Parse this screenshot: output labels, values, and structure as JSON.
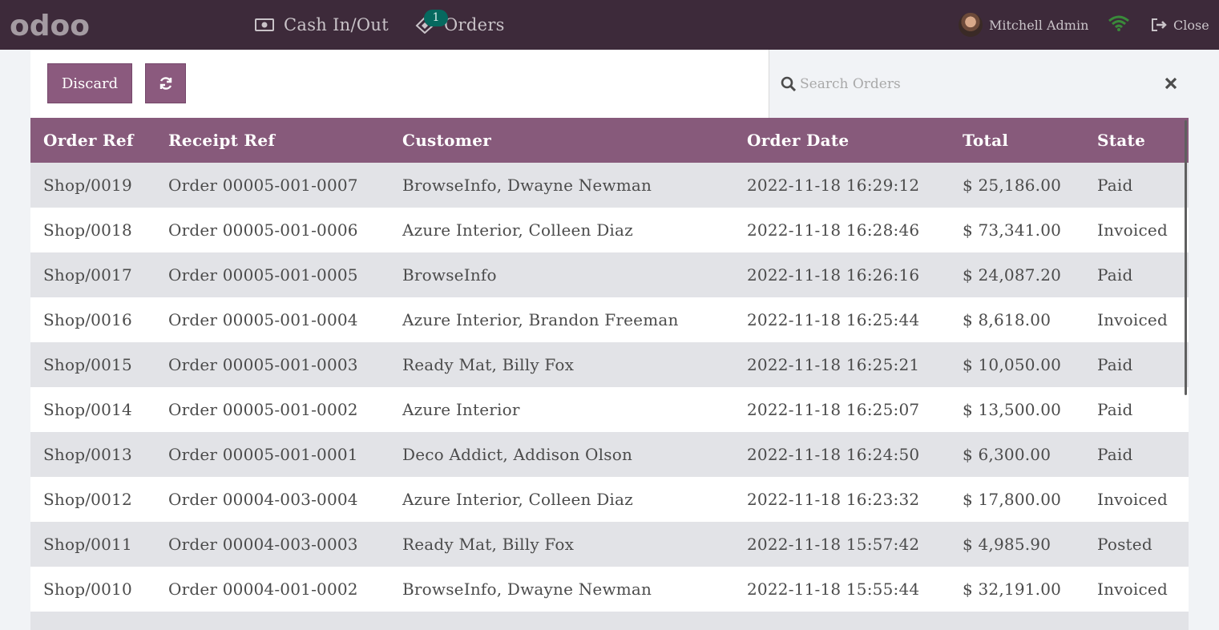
{
  "navbar": {
    "logo_text": "odoo",
    "cash_label": "Cash In/Out",
    "orders_label": "Orders",
    "orders_badge": "1",
    "user_name": "Mitchell Admin",
    "close_label": "Close",
    "wifi_color": "#3a8a3a"
  },
  "controls": {
    "discard_label": "Discard",
    "search_placeholder": "Search Orders"
  },
  "table": {
    "columns": [
      "Order Ref",
      "Receipt Ref",
      "Customer",
      "Order Date",
      "Total",
      "State"
    ],
    "rows": [
      [
        "Shop/0019",
        "Order 00005-001-0007",
        "BrowseInfo, Dwayne Newman",
        "2022-11-18 16:29:12",
        "$ 25,186.00",
        "Paid"
      ],
      [
        "Shop/0018",
        "Order 00005-001-0006",
        "Azure Interior, Colleen Diaz",
        "2022-11-18 16:28:46",
        "$ 73,341.00",
        "Invoiced"
      ],
      [
        "Shop/0017",
        "Order 00005-001-0005",
        "BrowseInfo",
        "2022-11-18 16:26:16",
        "$ 24,087.20",
        "Paid"
      ],
      [
        "Shop/0016",
        "Order 00005-001-0004",
        "Azure Interior, Brandon Freeman",
        "2022-11-18 16:25:44",
        "$ 8,618.00",
        "Invoiced"
      ],
      [
        "Shop/0015",
        "Order 00005-001-0003",
        "Ready Mat, Billy Fox",
        "2022-11-18 16:25:21",
        "$ 10,050.00",
        "Paid"
      ],
      [
        "Shop/0014",
        "Order 00005-001-0002",
        "Azure Interior",
        "2022-11-18 16:25:07",
        "$ 13,500.00",
        "Paid"
      ],
      [
        "Shop/0013",
        "Order 00005-001-0001",
        "Deco Addict, Addison Olson",
        "2022-11-18 16:24:50",
        "$ 6,300.00",
        "Paid"
      ],
      [
        "Shop/0012",
        "Order 00004-003-0004",
        "Azure Interior, Colleen Diaz",
        "2022-11-18 16:23:32",
        "$ 17,800.00",
        "Invoiced"
      ],
      [
        "Shop/0011",
        "Order 00004-003-0003",
        "Ready Mat, Billy Fox",
        "2022-11-18 15:57:42",
        "$ 4,985.90",
        "Posted"
      ],
      [
        "Shop/0010",
        "Order 00004-001-0002",
        "BrowseInfo, Dwayne Newman",
        "2022-11-18 15:55:44",
        "$ 32,191.00",
        "Invoiced"
      ]
    ]
  }
}
